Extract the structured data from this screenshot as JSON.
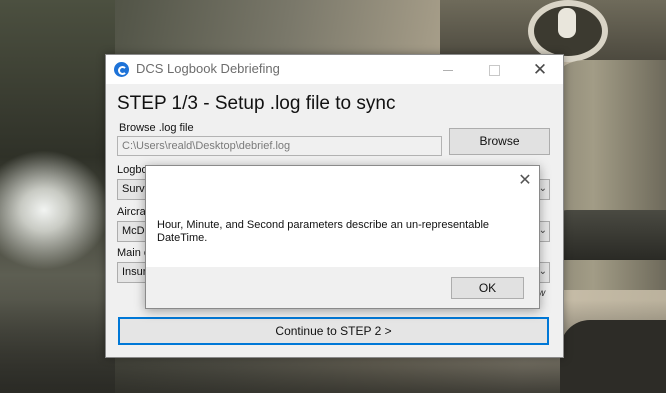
{
  "window": {
    "title": "DCS Logbook Debriefing",
    "close_glyph": "✕"
  },
  "step": {
    "title": "STEP 1/3 - Setup .log file to sync"
  },
  "log_file": {
    "label": "Browse .log file",
    "value": "C:\\Users\\reald\\Desktop\\debrief.log",
    "browse_label": "Browse"
  },
  "logbook": {
    "label": "Logbo",
    "value": "Survi"
  },
  "aircraft": {
    "label": "Aircra",
    "value": "McDo"
  },
  "main": {
    "label": "Main e",
    "value": "Insur",
    "trailing_text": "w"
  },
  "continue_label": "Continue to STEP 2 >",
  "dialog": {
    "message": "Hour, Minute, and Second parameters describe an un-representable DateTime.",
    "ok_label": "OK",
    "close_glyph": "✕"
  },
  "icons": {
    "app": "app-logo-icon",
    "close": "close-icon",
    "minimize": "minimize-icon",
    "maximize": "maximize-icon",
    "dropdown": "chevron-down-icon"
  },
  "colors": {
    "accent": "#0078d7",
    "window_bg": "#f0f0f0"
  }
}
